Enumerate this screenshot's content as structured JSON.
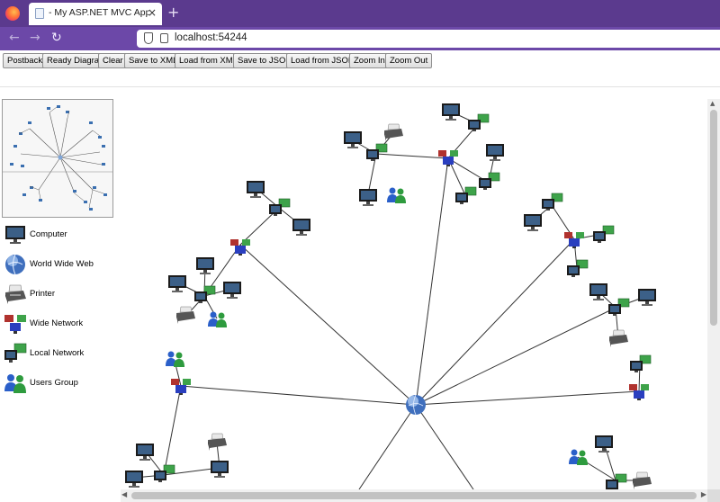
{
  "browser": {
    "tab_title": "- My ASP.NET MVC Application",
    "tab_close": "×",
    "new_tab": "+",
    "url": "localhost:54244",
    "back": "←",
    "forward": "→",
    "reload": "↻"
  },
  "toolbar": {
    "buttons": [
      "Postback",
      "Ready Diagram",
      "Clear",
      "Save to XML",
      "Load from XML",
      "Save to JSON",
      "Load from JSON",
      "Zoom In",
      "Zoom Out"
    ]
  },
  "palette": {
    "items": [
      {
        "label": "Computer",
        "icon": "computer-icon"
      },
      {
        "label": "World Wide Web",
        "icon": "globe-icon"
      },
      {
        "label": "Printer",
        "icon": "printer-icon"
      },
      {
        "label": "Wide Network",
        "icon": "wide-network-icon"
      },
      {
        "label": "Local Network",
        "icon": "local-network-icon"
      },
      {
        "label": "Users Group",
        "icon": "users-group-icon"
      }
    ]
  },
  "colors": {
    "chrome_tabbar": "#5b3a8e",
    "chrome_navbar": "#6c48a8",
    "link_line": "#333333"
  }
}
